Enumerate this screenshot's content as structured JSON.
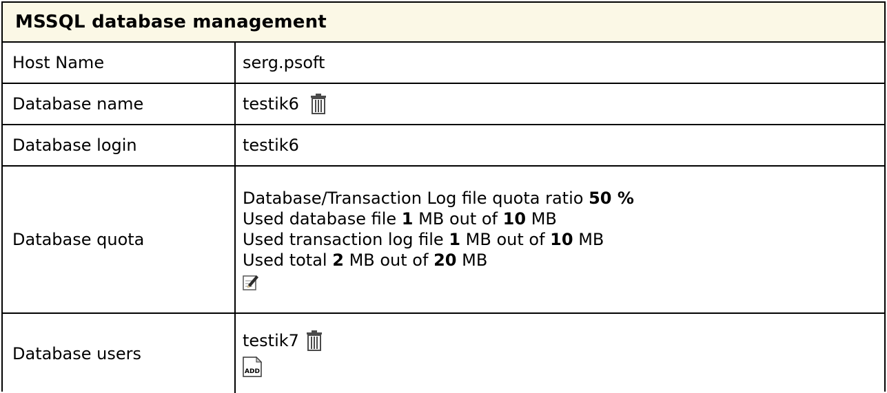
{
  "title": "MSSQL database management",
  "rows": {
    "host": {
      "label": "Host Name",
      "value": "serg.psoft"
    },
    "db_name": {
      "label": "Database name",
      "value": "testik6",
      "delete_icon": "trash-icon"
    },
    "db_login": {
      "label": "Database login",
      "value": "testik6"
    },
    "quota": {
      "label": "Database quota",
      "ratio_text": "Database/Transaction Log file quota ratio",
      "ratio_value": "50 %",
      "used_db_prefix": "Used database file",
      "used_db": "1",
      "used_db_of": "MB out of",
      "used_db_total": "10",
      "used_db_unit": "MB",
      "used_log_prefix": "Used transaction log file",
      "used_log": "1",
      "used_log_of": "MB out of",
      "used_log_total": "10",
      "used_log_unit": "MB",
      "used_total_prefix": "Used total",
      "used_total": "2",
      "used_total_of": "MB out of",
      "used_total_total": "20",
      "used_total_unit": "MB",
      "edit_icon": "edit-icon"
    },
    "users": {
      "label": "Database users",
      "user": "testik7",
      "delete_icon": "trash-icon",
      "add_icon_text": "ADD"
    }
  }
}
